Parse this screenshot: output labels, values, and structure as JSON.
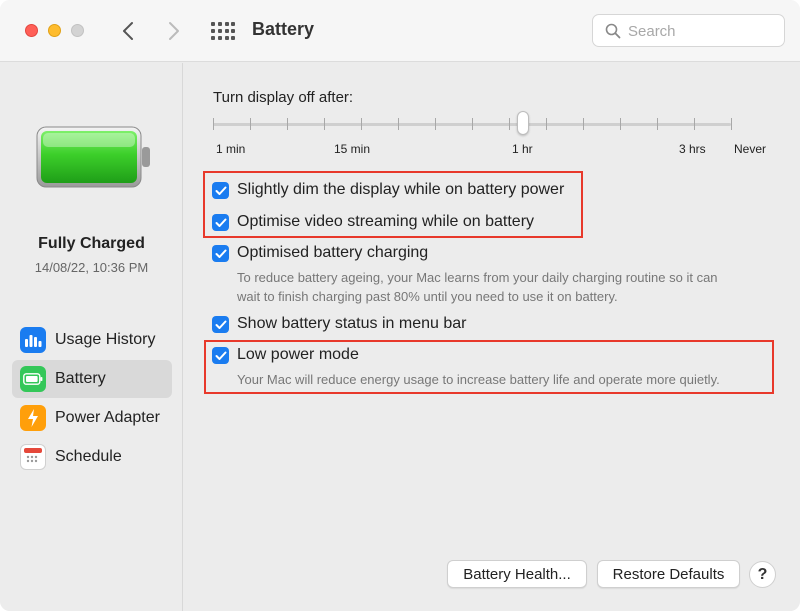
{
  "window": {
    "title": "Battery"
  },
  "search": {
    "placeholder": "Search"
  },
  "sidebar": {
    "status_title": "Fully Charged",
    "status_time": "14/08/22, 10:36 PM",
    "items": [
      {
        "label": "Usage History",
        "icon": "bar-chart-icon",
        "color": "#1a7cf0",
        "selected": false
      },
      {
        "label": "Battery",
        "icon": "battery-icon",
        "color": "#34c759",
        "selected": true
      },
      {
        "label": "Power Adapter",
        "icon": "lightning-bolt-icon",
        "color": "#ff9f0a",
        "selected": false
      },
      {
        "label": "Schedule",
        "icon": "calendar-icon",
        "color": "#e5483a",
        "selected": false
      }
    ]
  },
  "slider": {
    "label": "Turn display off after:",
    "tick_labels": [
      "1 min",
      "15 min",
      "1 hr",
      "3 hrs",
      "Never"
    ],
    "selected": "1 hr"
  },
  "options": [
    {
      "label": "Slightly dim the display while on battery power",
      "checked": true,
      "highlighted": true
    },
    {
      "label": "Optimise video streaming while on battery",
      "checked": true,
      "highlighted": true
    },
    {
      "label": "Optimised battery charging",
      "checked": true,
      "highlighted": false,
      "desc_line1": "To reduce battery ageing, your Mac learns from your daily charging routine so it can",
      "desc_line2": "wait to finish charging past 80% until you need to use it on battery."
    },
    {
      "label": "Show battery status in menu bar",
      "checked": true,
      "highlighted": false
    },
    {
      "label": "Low power mode",
      "checked": true,
      "highlighted": true,
      "desc_line1": "Your Mac will reduce energy usage to increase battery life and operate more quietly."
    }
  ],
  "buttons": {
    "battery_health": "Battery Health...",
    "restore_defaults": "Restore Defaults",
    "help": "?"
  },
  "colors": {
    "accent": "#1a7cf0",
    "highlight": "#e8392b",
    "battery_fill": "#34c759"
  }
}
